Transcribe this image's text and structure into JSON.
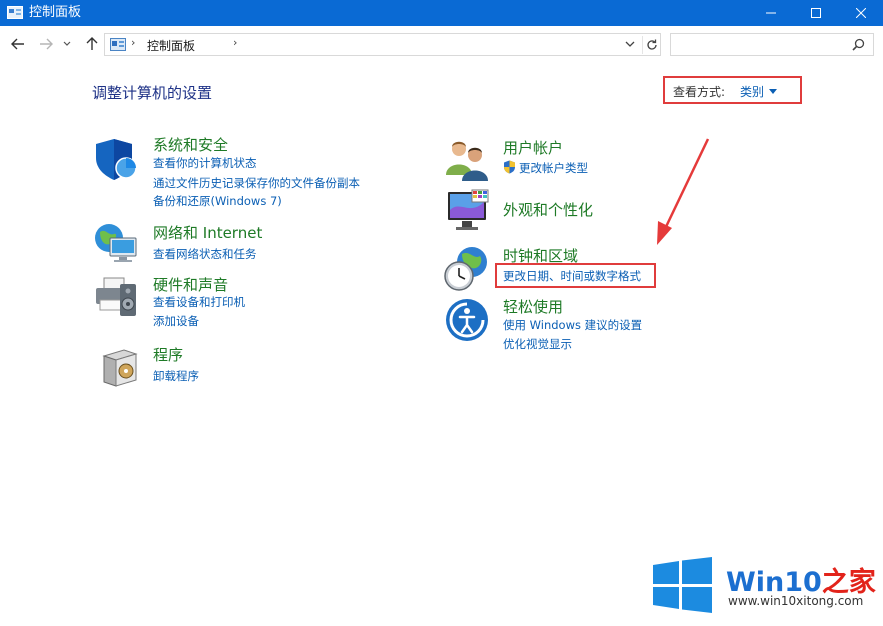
{
  "window": {
    "title": "控制面板",
    "controls": {
      "minimize": "–",
      "maximize": "□",
      "close": "✕"
    }
  },
  "navbar": {
    "breadcrumb": "控制面板",
    "search_placeholder": ""
  },
  "content": {
    "title": "调整计算机的设置",
    "view_by": {
      "label": "查看方式:",
      "value": "类别"
    }
  },
  "categories": {
    "security": {
      "title": "系统和安全",
      "links": [
        "查看你的计算机状态",
        "通过文件历史记录保存你的文件备份副本",
        "备份和还原(Windows 7)"
      ]
    },
    "network": {
      "title": "网络和 Internet",
      "links": [
        "查看网络状态和任务"
      ]
    },
    "hardware": {
      "title": "硬件和声音",
      "links": [
        "查看设备和打印机",
        "添加设备"
      ]
    },
    "programs": {
      "title": "程序",
      "links": [
        "卸载程序"
      ]
    },
    "users": {
      "title": "用户帐户",
      "links": [
        "更改帐户类型"
      ]
    },
    "appearance": {
      "title": "外观和个性化",
      "links": []
    },
    "clock": {
      "title": "时钟和区域",
      "links": [
        "更改日期、时间或数字格式"
      ]
    },
    "ease": {
      "title": "轻松使用",
      "links": [
        "使用 Windows 建议的设置",
        "优化视觉显示"
      ]
    }
  },
  "watermark": {
    "name": "Win10",
    "name_suffix": "之家",
    "url": "www.win10xitong.com"
  },
  "colors": {
    "titlebar": "#0a6ad4",
    "category_title": "#1e7a26",
    "link": "#0b5fb4",
    "highlight": "#e03c3c"
  }
}
